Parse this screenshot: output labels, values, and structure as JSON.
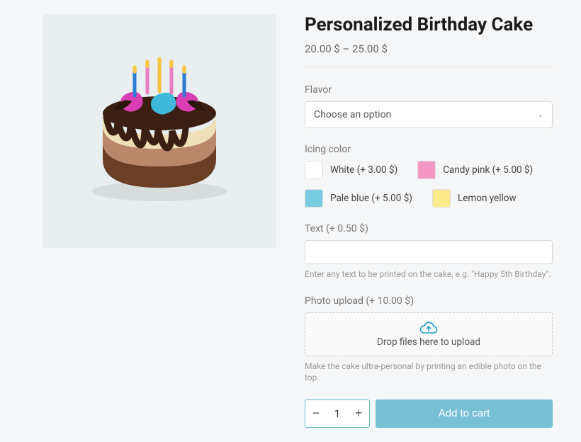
{
  "product": {
    "title": "Personalized Birthday Cake",
    "price_range": "20.00 $ – 25.00 $"
  },
  "flavor": {
    "label": "Flavor",
    "placeholder": "Choose an option"
  },
  "icing": {
    "label": "Icing color",
    "options": [
      {
        "label": "White (+ 3.00 $)",
        "color": "#ffffff"
      },
      {
        "label": "Candy pink (+ 5.00 $)",
        "color": "#f497c3"
      },
      {
        "label": "Pale blue (+ 5.00 $)",
        "color": "#79ccdf"
      },
      {
        "label": "Lemon yellow",
        "color": "#fce98a"
      }
    ]
  },
  "text_field": {
    "label": "Text (+ 0.50 $)",
    "help": "Enter any text to be printed on the cake, e.g. \"Happy 5th Birthday\"."
  },
  "photo": {
    "label": "Photo upload (+ 10.00 $)",
    "dropzone": "Drop files here to upload",
    "help": "Make the cake ultra-personal by printing an edible photo on the top."
  },
  "cart": {
    "quantity": "1",
    "add_label": "Add to cart"
  }
}
